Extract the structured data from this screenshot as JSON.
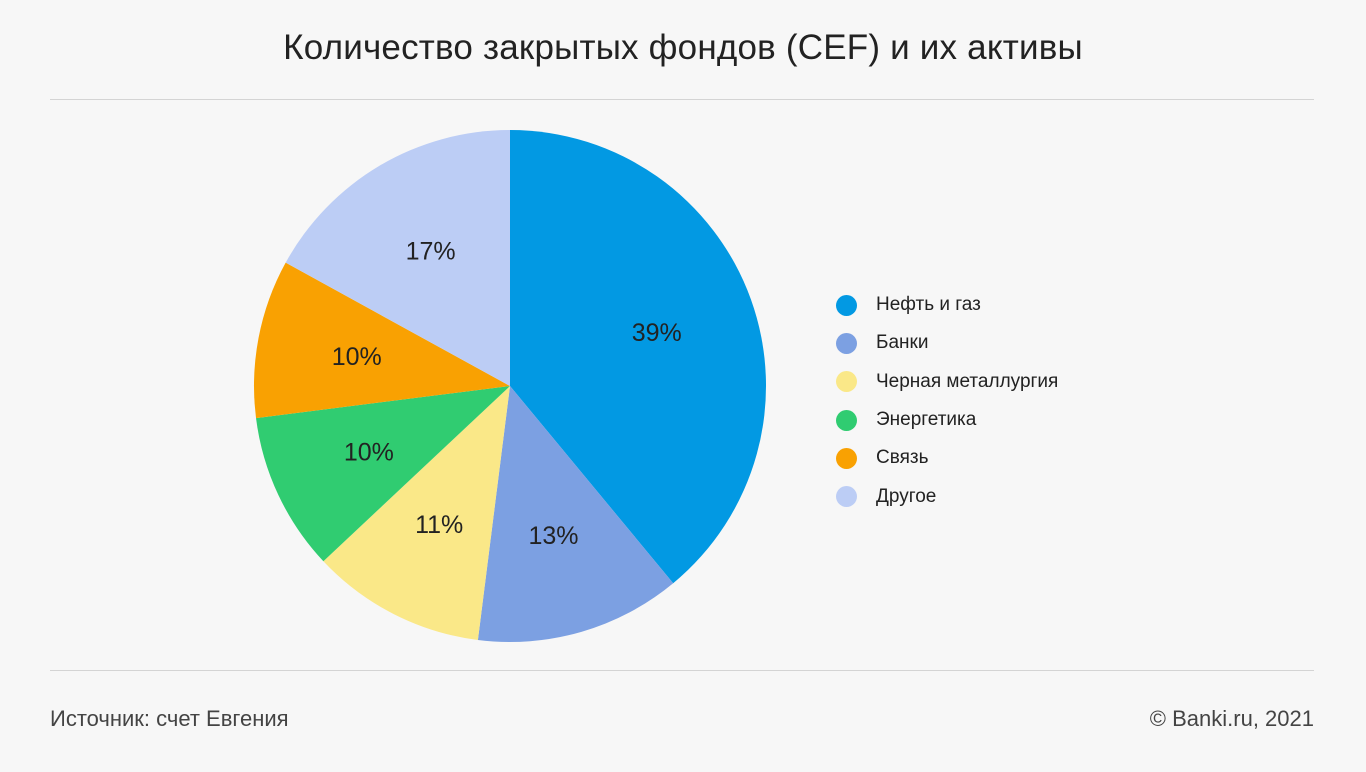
{
  "chart_data": {
    "type": "pie",
    "title": "Количество закрытых фондов (CEF) и их активы",
    "slices": [
      {
        "label": "Нефть и газ",
        "value": 39,
        "display": "39%",
        "color": "#0299e3"
      },
      {
        "label": "Банки",
        "value": 13,
        "display": "13%",
        "color": "#7ca0e2"
      },
      {
        "label": "Черная металлургия",
        "value": 11,
        "display": "11%",
        "color": "#fae888"
      },
      {
        "label": "Энергетика",
        "value": 10,
        "display": "10%",
        "color": "#30cc71"
      },
      {
        "label": "Связь",
        "value": 10,
        "display": "10%",
        "color": "#f9a102"
      },
      {
        "label": "Другое",
        "value": 17,
        "display": "17%",
        "color": "#bccdf5"
      }
    ],
    "start": "12 o'clock",
    "direction": "clockwise",
    "legend_position": "right"
  },
  "footer": {
    "source": "Источник: счет Евгения",
    "copyright": "© Banki.ru, 2021"
  }
}
